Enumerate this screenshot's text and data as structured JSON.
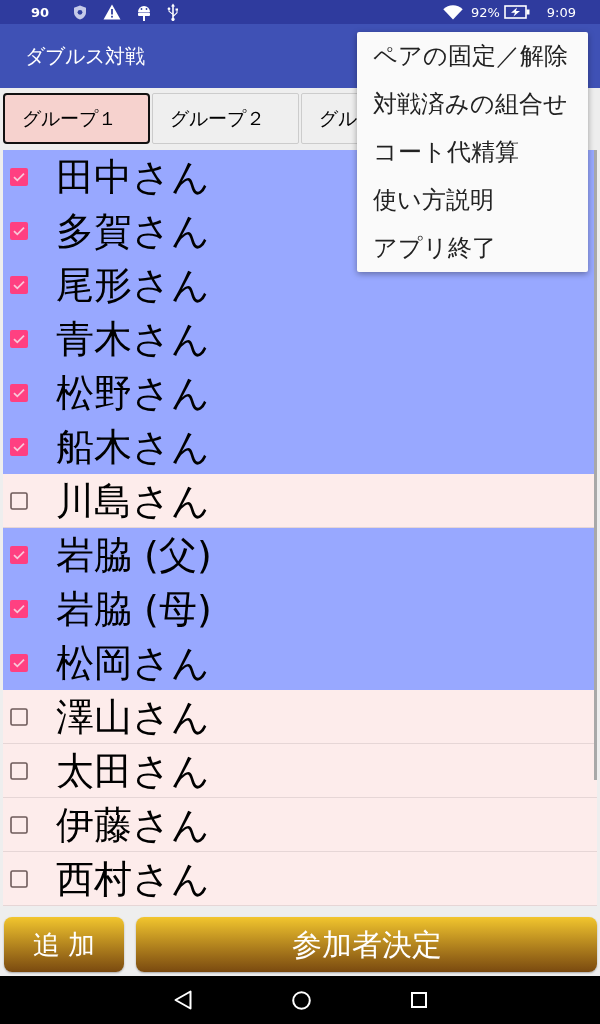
{
  "status_bar": {
    "notification_count": "90",
    "battery": "92%",
    "time": "9:09"
  },
  "app_bar": {
    "title": "ダブルス対戦"
  },
  "tabs": [
    {
      "label": "グループ１",
      "selected": true
    },
    {
      "label": "グループ２",
      "selected": false
    },
    {
      "label": "グル",
      "selected": false
    }
  ],
  "players": [
    {
      "name": "田中さん",
      "checked": true
    },
    {
      "name": "多賀さん",
      "checked": true
    },
    {
      "name": "尾形さん",
      "checked": true
    },
    {
      "name": "青木さん",
      "checked": true
    },
    {
      "name": "松野さん",
      "checked": true
    },
    {
      "name": "船木さん",
      "checked": true
    },
    {
      "name": "川島さん",
      "checked": false
    },
    {
      "name": "岩脇 (父)",
      "checked": true
    },
    {
      "name": "岩脇 (母)",
      "checked": true
    },
    {
      "name": "松岡さん",
      "checked": true
    },
    {
      "name": "澤山さん",
      "checked": false
    },
    {
      "name": "太田さん",
      "checked": false
    },
    {
      "name": "伊藤さん",
      "checked": false
    },
    {
      "name": "西村さん",
      "checked": false
    }
  ],
  "overflow_menu": {
    "items": [
      "ペアの固定／解除",
      "対戦済みの組合せ",
      "コート代精算",
      "使い方説明",
      "アプリ終了"
    ]
  },
  "buttons": {
    "add": "追 加",
    "confirm": "参加者決定"
  }
}
